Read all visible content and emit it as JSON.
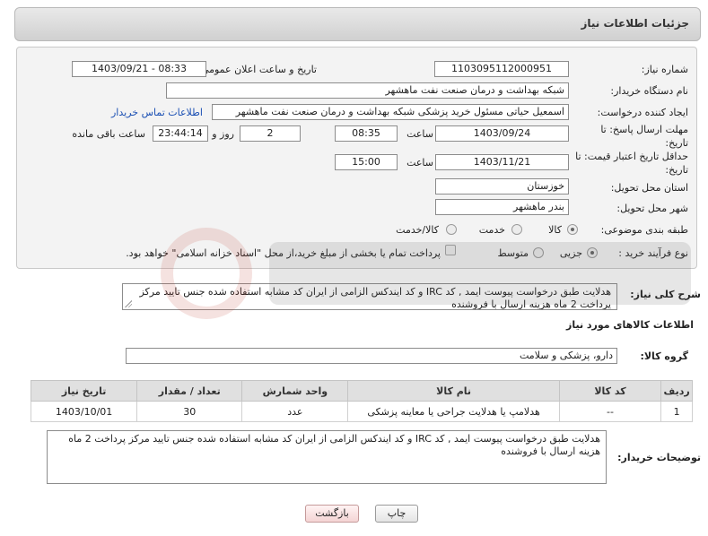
{
  "header": {
    "title": "جزئیات اطلاعات نیاز"
  },
  "form": {
    "need_number_label": "شماره نیاز:",
    "need_number": "1103095112000951",
    "announce_datetime_label": "تاریخ و ساعت اعلان عمومی:",
    "announce_datetime": "1403/09/21 - 08:33",
    "buyer_org_label": "نام دستگاه خریدار:",
    "buyer_org": "شبکه بهداشت و درمان صنعت نفت ماهشهر",
    "creator_label": "ایجاد کننده درخواست:",
    "creator": "اسمعیل حیاتی مسئول خرید پزشکی شبکه بهداشت و درمان صنعت نفت ماهشهر",
    "buyer_contact_link": "اطلاعات تماس خریدار",
    "reply_deadline_label": "مهلت ارسال پاسخ: تا تاریخ:",
    "reply_date": "1403/09/24",
    "time_label": "ساعت",
    "reply_time": "08:35",
    "days_value": "2",
    "days_label": "روز و",
    "remaining_time": "23:44:14",
    "remaining_label": "ساعت باقی مانده",
    "price_validity_label": "حداقل تاریخ اعتبار قیمت: تا تاریخ:",
    "validity_date": "1403/11/21",
    "validity_time_label": "ساعت",
    "validity_time": "15:00",
    "province_label": "استان محل تحویل:",
    "province": "خوزستان",
    "city_label": "شهر محل تحویل:",
    "city": "بندر ماهشهر",
    "category_label": "طبقه بندی موضوعی:",
    "category_options": [
      "کالا",
      "خدمت",
      "کالا/خدمت"
    ],
    "process_label": "نوع فرآیند خرید :",
    "process_options": [
      "جزیی",
      "متوسط"
    ],
    "payment_note": "پرداخت تمام یا بخشی از مبلغ خرید،از محل \"اسناد خزانه اسلامی\" خواهد بود."
  },
  "description": {
    "label": "شرح کلی نیاز:",
    "text": "هدلایت طبق درخواست پیوست ایمد , کد IRC و کد ایندکس الزامی از ایران کد مشابه استفاده شده جنس تایید مرکز پرداخت 2 ماه هزینه ارسال با فروشنده"
  },
  "goods": {
    "section_title": "اطلاعات کالاهای مورد نیاز",
    "group_label": "گروه کالا:",
    "group_value": "دارو، پزشکی و سلامت",
    "columns": [
      "ردیف",
      "کد کالا",
      "نام کالا",
      "واحد شمارش",
      "تعداد / مقدار",
      "تاریخ نیاز"
    ],
    "rows": [
      {
        "index": "1",
        "code": "--",
        "name": "هدلامپ یا هدلایت جراحی یا معاینه پزشکی",
        "unit": "عدد",
        "qty": "30",
        "date": "1403/10/01"
      }
    ]
  },
  "buyer_notes": {
    "label": "توضیحات خریدار:",
    "text": "هدلایت طبق درخواست پیوست ایمد , کد IRC و کد ایندکس الزامی از ایران کد مشابه استفاده شده جنس تایید مرکز پرداخت 2 ماه هزینه ارسال با فروشنده"
  },
  "buttons": {
    "print": "چاپ",
    "back": "بازگشت"
  },
  "colors": {
    "link": "#1a4fb3",
    "header_bg": "#d8d8d8",
    "panel_bg": "#f3f3f3"
  }
}
